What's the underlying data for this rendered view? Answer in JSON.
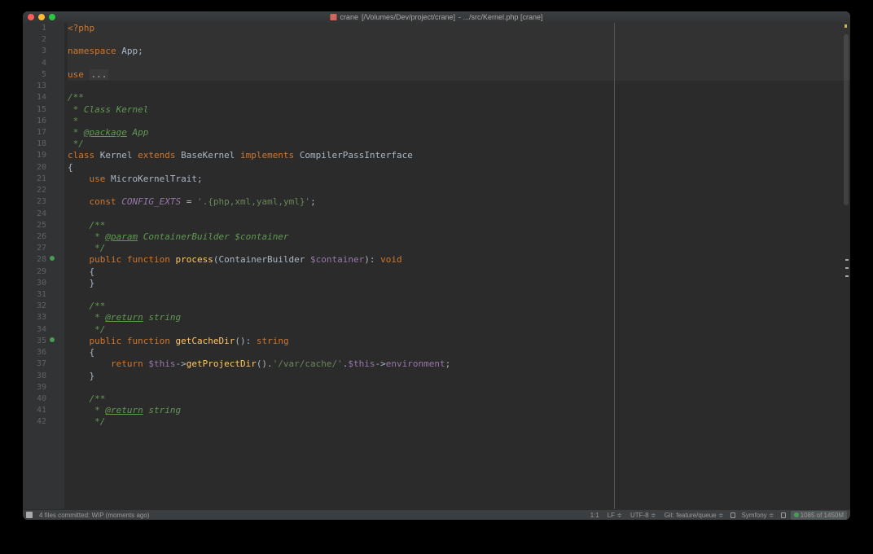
{
  "titlebar": {
    "project": "crane",
    "path": "[/Volumes/Dev/project/crane]",
    "suffix": "- .../src/Kernel.php [crane]"
  },
  "statusbar": {
    "vcs": "4 files committed: WIP (moments ago)",
    "pos": "1:1",
    "lineend": "LF",
    "encoding": "UTF-8",
    "branch": "Git: feature/queue",
    "context": "Symfony",
    "memory": "1085 of 1450M"
  },
  "code": {
    "lines": [
      {
        "n": 1,
        "hl": true,
        "tokens": [
          [
            "kw",
            "<?php"
          ]
        ]
      },
      {
        "n": 2,
        "hl": true,
        "tokens": []
      },
      {
        "n": 3,
        "hl": true,
        "tokens": [
          [
            "kw",
            "namespace"
          ],
          [
            "op",
            " App;"
          ]
        ]
      },
      {
        "n": 4,
        "hl": true,
        "tokens": []
      },
      {
        "n": 5,
        "hl": true,
        "tokens": [
          [
            "kw",
            "use "
          ],
          [
            "folded",
            "..."
          ]
        ]
      },
      {
        "n": 13,
        "tokens": []
      },
      {
        "n": 14,
        "tokens": [
          [
            "doc",
            "/**"
          ]
        ]
      },
      {
        "n": 15,
        "tokens": [
          [
            "doc",
            " * Class Kernel"
          ]
        ]
      },
      {
        "n": 16,
        "tokens": [
          [
            "doc",
            " *"
          ]
        ]
      },
      {
        "n": 17,
        "tokens": [
          [
            "doc",
            " * "
          ],
          [
            "docann",
            "@package"
          ],
          [
            "doc",
            " App"
          ]
        ]
      },
      {
        "n": 18,
        "tokens": [
          [
            "doc",
            " */"
          ]
        ]
      },
      {
        "n": 19,
        "tokens": [
          [
            "kw",
            "class "
          ],
          [
            "cls",
            "Kernel "
          ],
          [
            "kw",
            "extends "
          ],
          [
            "cls",
            "BaseKernel "
          ],
          [
            "kw",
            "implements "
          ],
          [
            "cls",
            "CompilerPassInterface"
          ]
        ]
      },
      {
        "n": 20,
        "tokens": [
          [
            "op",
            "{"
          ]
        ]
      },
      {
        "n": 21,
        "tokens": [
          [
            "op",
            "    "
          ],
          [
            "kw",
            "use "
          ],
          [
            "cls",
            "MicroKernelTrait"
          ],
          [
            "op",
            ";"
          ]
        ]
      },
      {
        "n": 22,
        "tokens": []
      },
      {
        "n": 23,
        "tokens": [
          [
            "op",
            "    "
          ],
          [
            "kw",
            "const "
          ],
          [
            "const",
            "CONFIG_EXTS"
          ],
          [
            "op",
            " = "
          ],
          [
            "str",
            "'.{php,xml,yaml,yml}'"
          ],
          [
            "op",
            ";"
          ]
        ]
      },
      {
        "n": 24,
        "tokens": []
      },
      {
        "n": 25,
        "tokens": [
          [
            "op",
            "    "
          ],
          [
            "doc",
            "/**"
          ]
        ]
      },
      {
        "n": 26,
        "tokens": [
          [
            "op",
            "    "
          ],
          [
            "doc",
            " * "
          ],
          [
            "docann",
            "@param"
          ],
          [
            "doc",
            " ContainerBuilder $container"
          ]
        ]
      },
      {
        "n": 27,
        "tokens": [
          [
            "op",
            "    "
          ],
          [
            "doc",
            " */"
          ]
        ]
      },
      {
        "n": 28,
        "marker": "green",
        "tokens": [
          [
            "op",
            "    "
          ],
          [
            "kw",
            "public function "
          ],
          [
            "def",
            "process"
          ],
          [
            "op",
            "(ContainerBuilder "
          ],
          [
            "var",
            "$container"
          ],
          [
            "op",
            "): "
          ],
          [
            "kw",
            "void"
          ]
        ]
      },
      {
        "n": 29,
        "tokens": [
          [
            "op",
            "    {"
          ]
        ]
      },
      {
        "n": 30,
        "tokens": [
          [
            "op",
            "    }"
          ]
        ]
      },
      {
        "n": 31,
        "tokens": []
      },
      {
        "n": 32,
        "tokens": [
          [
            "op",
            "    "
          ],
          [
            "doc",
            "/**"
          ]
        ]
      },
      {
        "n": 33,
        "tokens": [
          [
            "op",
            "    "
          ],
          [
            "doc",
            " * "
          ],
          [
            "docann",
            "@return"
          ],
          [
            "doc",
            " string"
          ]
        ]
      },
      {
        "n": 34,
        "tokens": [
          [
            "op",
            "    "
          ],
          [
            "doc",
            " */"
          ]
        ]
      },
      {
        "n": 35,
        "marker": "green",
        "tokens": [
          [
            "op",
            "    "
          ],
          [
            "kw",
            "public function "
          ],
          [
            "def",
            "getCacheDir"
          ],
          [
            "op",
            "(): "
          ],
          [
            "kw",
            "string"
          ]
        ]
      },
      {
        "n": 36,
        "tokens": [
          [
            "op",
            "    {"
          ]
        ]
      },
      {
        "n": 37,
        "tokens": [
          [
            "op",
            "        "
          ],
          [
            "kw",
            "return "
          ],
          [
            "var",
            "$this"
          ],
          [
            "op",
            "->"
          ],
          [
            "def",
            "getProjectDir"
          ],
          [
            "op",
            "()."
          ],
          [
            "str",
            "'/var/cache/'"
          ],
          [
            "op",
            "."
          ],
          [
            "var",
            "$this"
          ],
          [
            "op",
            "->"
          ],
          [
            "var",
            "environment"
          ],
          [
            "op",
            ";"
          ]
        ]
      },
      {
        "n": 38,
        "tokens": [
          [
            "op",
            "    }"
          ]
        ]
      },
      {
        "n": 39,
        "tokens": []
      },
      {
        "n": 40,
        "tokens": [
          [
            "op",
            "    "
          ],
          [
            "doc",
            "/**"
          ]
        ]
      },
      {
        "n": 41,
        "tokens": [
          [
            "op",
            "    "
          ],
          [
            "doc",
            " * "
          ],
          [
            "docann",
            "@return"
          ],
          [
            "doc",
            " string"
          ]
        ]
      },
      {
        "n": 42,
        "tokens": [
          [
            "op",
            "    "
          ],
          [
            "doc",
            " */"
          ]
        ]
      }
    ]
  }
}
